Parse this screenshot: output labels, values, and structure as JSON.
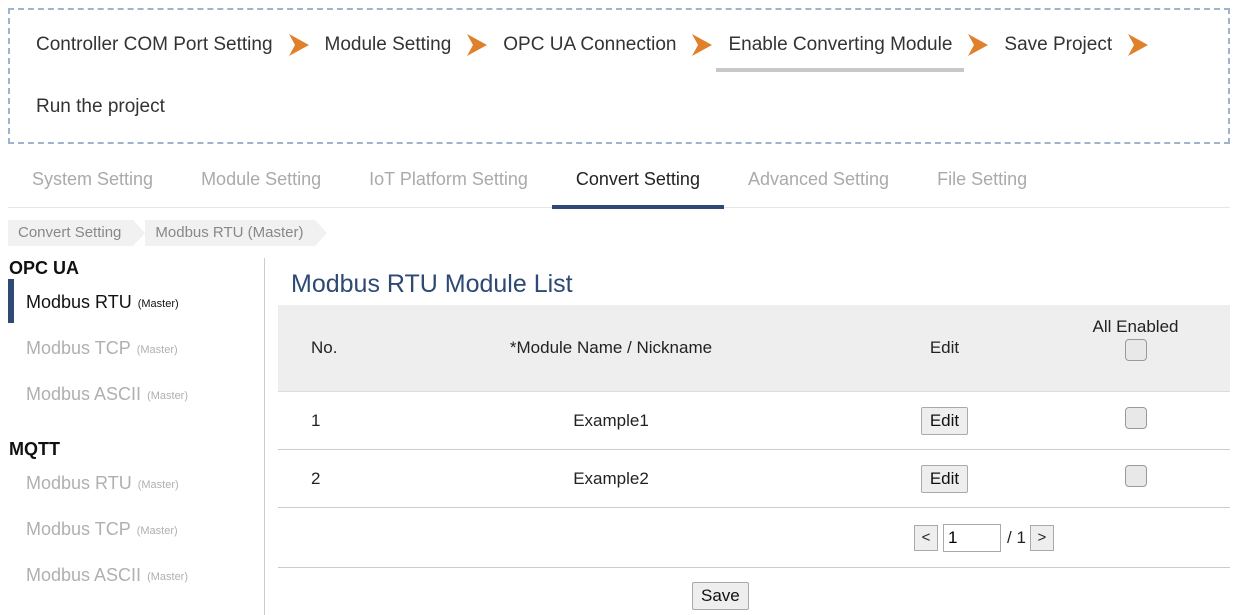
{
  "wizard": {
    "steps": [
      "Controller COM Port Setting",
      "Module Setting",
      "OPC UA Connection",
      "Enable Converting Module",
      "Save Project",
      "Run the project"
    ]
  },
  "tabs": [
    "System Setting",
    "Module Setting",
    "IoT Platform Setting",
    "Convert Setting",
    "Advanced Setting",
    "File Setting"
  ],
  "breadcrumb": [
    "Convert Setting",
    "Modbus RTU (Master)"
  ],
  "sidebar": {
    "groups": [
      {
        "title": "OPC UA",
        "items": [
          {
            "name": "Modbus RTU",
            "tag": "(Master)"
          },
          {
            "name": "Modbus TCP",
            "tag": "(Master)"
          },
          {
            "name": "Modbus ASCII",
            "tag": "(Master)"
          }
        ]
      },
      {
        "title": "MQTT",
        "items": [
          {
            "name": "Modbus RTU",
            "tag": "(Master)"
          },
          {
            "name": "Modbus TCP",
            "tag": "(Master)"
          },
          {
            "name": "Modbus ASCII",
            "tag": "(Master)"
          }
        ]
      }
    ]
  },
  "main": {
    "title": "Modbus RTU Module List",
    "headers": {
      "no": "No.",
      "name": "*Module Name / Nickname",
      "edit": "Edit",
      "enabled": "All Enabled"
    },
    "rows": [
      {
        "no": "1",
        "name": "Example1",
        "edit": "Edit"
      },
      {
        "no": "2",
        "name": "Example2",
        "edit": "Edit"
      }
    ],
    "pager": {
      "prev": "<",
      "page": "1",
      "total": "/ 1",
      "next": ">"
    },
    "save_label": "Save"
  },
  "colors": {
    "accent": "#2e4a74",
    "chevron": "#e0802a",
    "wizard_border": "#9fb3cc"
  }
}
